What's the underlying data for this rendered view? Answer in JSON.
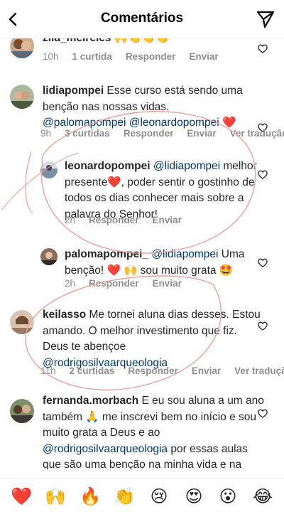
{
  "header": {
    "title": "Comentários"
  },
  "comments": [
    {
      "username": "zila_meireles",
      "text": " 🙌👏👏👏",
      "time": "10h",
      "likes": "1 curtida",
      "reply": "Responder",
      "send": "Enviar"
    },
    {
      "username": "lidiapompei",
      "text1": " Esse curso está sendo uma benção nas nossas vidas.",
      "mention1": "@palomapompei",
      "mention2": "@leonardopompei",
      "tail": " ❤️",
      "time": "9h",
      "likes": "3 curtidas",
      "reply": "Responder",
      "send": "Enviar",
      "translate": "Ver tradução"
    },
    {
      "username": "leonardopompei",
      "mention": "@lidiapompei",
      "text": " melhor presente❤️, poder sentir o gostinho de todos os dias conhecer mais sobre a palavra do Senhor!",
      "time": "2h",
      "reply": "Responder",
      "send": "Enviar"
    },
    {
      "username": "palomapompei_",
      "mention": "@lidiapompei",
      "text": " Uma benção! ❤️ 🙌 sou muito grata 🤩",
      "time": "2h",
      "reply": "Responder",
      "send": "Enviar"
    },
    {
      "username": "keilasso",
      "text": " Me tornei aluna dias desses. Estou amando. O melhor investimento que fiz. Deus te abençoe",
      "mention": "@rodrigosilvaarqueologia",
      "time": "11h",
      "likes": "2 curtidas",
      "reply": "Responder",
      "send": "Enviar",
      "translate": "Ver tradução"
    },
    {
      "username": "fernanda.morbach",
      "text1": " E eu sou aluna a um ano também 🙏 me inscrevi bem no início e sou muito grata a Deus e ao",
      "mention": "@rodrigosilvaarqueologia",
      "text2": " por essas aulas que são uma benção na minha vida e na minha família 🙏"
    }
  ],
  "reactions": [
    "❤️",
    "🙌",
    "🔥",
    "👏",
    "😢",
    "😍",
    "😮",
    "😂"
  ]
}
